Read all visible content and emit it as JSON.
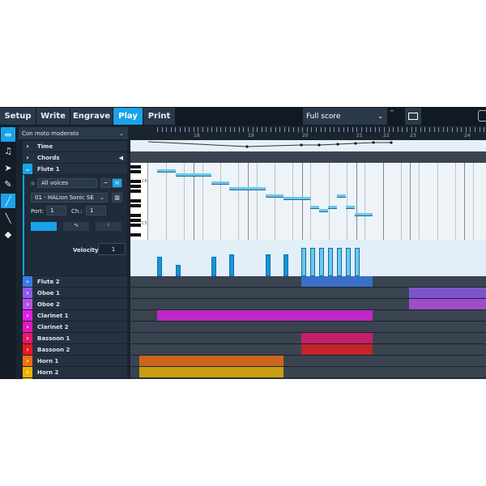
{
  "tabs": [
    {
      "label": "Setup"
    },
    {
      "label": "Write"
    },
    {
      "label": "Engrave"
    },
    {
      "label": "Play",
      "active": true
    },
    {
      "label": "Print"
    }
  ],
  "layout_select": {
    "value": "Full score"
  },
  "tempo_select": {
    "value": "Con moto moderato"
  },
  "tools": [
    "playback-mode-icon",
    "note-icon",
    "select-arrow-icon",
    "pencil-icon",
    "line-tool-icon",
    "brush-icon",
    "eraser-icon"
  ],
  "ruler": {
    "bars": [
      "18",
      "19",
      "20",
      "21",
      "22",
      "23",
      "24"
    ]
  },
  "global_tracks": [
    {
      "label": "Time"
    },
    {
      "label": "Chords"
    }
  ],
  "flute1": {
    "label": "Flute 1",
    "voices": "All voices",
    "instrument": "01 - HALion Sonic SE",
    "port_label": "Port:",
    "port": "1",
    "channel_label": "Ch.:",
    "channel": "1",
    "keyboard_labels": [
      "C6",
      "C5"
    ],
    "velocity_label": "Velocity",
    "velocity_value": "1"
  },
  "tracks": [
    {
      "label": "Flute 2",
      "color": "#3b7be8"
    },
    {
      "label": "Oboe 1",
      "color": "#8f5ae8"
    },
    {
      "label": "Oboe 2",
      "color": "#b850e8"
    },
    {
      "label": "Clarinet 1",
      "color": "#e020e0"
    },
    {
      "label": "Clarinet 2",
      "color": "#e018b8"
    },
    {
      "label": "Bassoon 1",
      "color": "#e8186a"
    },
    {
      "label": "Bassoon 2",
      "color": "#e81a20"
    },
    {
      "label": "Horn 1",
      "color": "#f07010"
    },
    {
      "label": "Horn 2",
      "color": "#f0b400"
    },
    {
      "label": "",
      "color": "#d8e020"
    }
  ],
  "accent": "#19a3e8"
}
